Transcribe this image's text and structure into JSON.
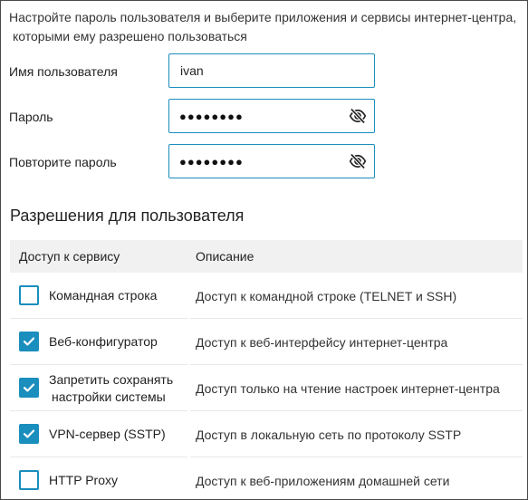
{
  "intro": {
    "line1": "Настройте пароль пользователя и выберите приложения и сервисы интернет-центра,",
    "line2": "которыми ему разрешено пользоваться"
  },
  "form": {
    "username": {
      "label": "Имя пользователя",
      "value": "ivan"
    },
    "password": {
      "label": "Пароль",
      "value": "●●●●●●●●"
    },
    "password_repeat": {
      "label": "Повторите пароль",
      "value": "●●●●●●●●"
    }
  },
  "permissions": {
    "title": "Разрешения для пользователя",
    "columns": [
      "Доступ к сервису",
      "Описание"
    ],
    "rows": [
      {
        "name": "Командная строка",
        "name_line2": "",
        "description": "Доступ к командной строке (TELNET и SSH)",
        "checked": false
      },
      {
        "name": "Веб-конфигуратор",
        "name_line2": "",
        "description": "Доступ к веб-интерфейсу интернет-центра",
        "checked": true
      },
      {
        "name": "Запретить сохранять",
        "name_line2": "настройки системы",
        "description": "Доступ только на чтение настроек интернет-центра",
        "checked": true
      },
      {
        "name": "VPN-сервер (SSTP)",
        "name_line2": "",
        "description": "Доступ в локальную сеть по протоколу SSTP",
        "checked": true
      },
      {
        "name": "HTTP Proxy",
        "name_line2": "",
        "description": "Доступ к веб-приложениям домашней сети",
        "checked": false
      }
    ]
  },
  "colors": {
    "accent": "#1a8ebd",
    "header_bg": "#f1f1f1"
  },
  "icons": {
    "password_toggle": "eye-off-icon",
    "checkbox_checked": "checkmark-icon"
  }
}
